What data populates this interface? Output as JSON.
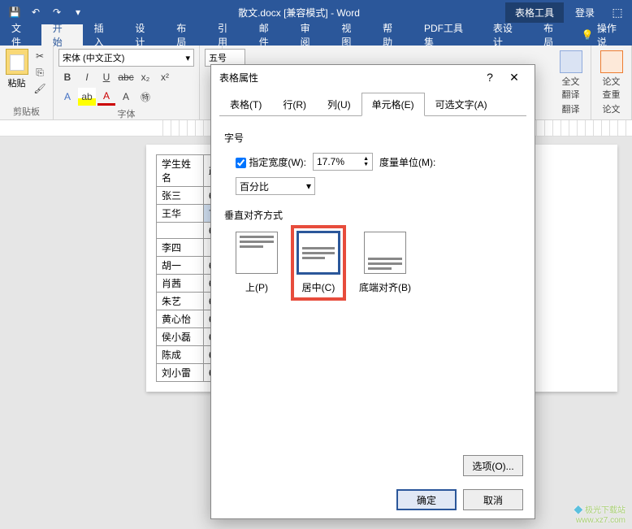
{
  "titlebar": {
    "document_title": "散文.docx [兼容模式] - Word",
    "context_tool": "表格工具",
    "login": "登录"
  },
  "ribbon_tabs": {
    "file": "文件",
    "home": "开始",
    "insert": "插入",
    "design": "设计",
    "layout": "布局",
    "references": "引用",
    "mail": "邮件",
    "review": "审阅",
    "view": "视图",
    "help": "帮助",
    "pdf": "PDF工具集",
    "table_design": "表设计",
    "table_layout": "布局",
    "tell_me": "操作说"
  },
  "ribbon": {
    "clipboard": {
      "paste": "粘贴",
      "label": "剪贴板"
    },
    "font": {
      "font_name": "宋体 (中文正文)",
      "font_size": "五号",
      "label": "字体"
    },
    "translate": {
      "label": "全文\n翻译",
      "group": "翻译"
    },
    "paper": {
      "label": "论文\n查重",
      "group": "论文"
    }
  },
  "table_data": {
    "header": [
      "学生姓名",
      "政治"
    ],
    "rows": [
      [
        "张三",
        "60"
      ],
      [
        "王华",
        "70"
      ],
      [
        "",
        "60"
      ],
      [
        "李四",
        ""
      ],
      [
        "胡一",
        "60"
      ],
      [
        "肖茜",
        "60"
      ],
      [
        "朱艺",
        "60"
      ],
      [
        "黄心怡",
        "60"
      ],
      [
        "侯小磊",
        "60"
      ],
      [
        "陈成",
        "60"
      ],
      [
        "刘小雷",
        "60"
      ]
    ]
  },
  "dialog": {
    "title": "表格属性",
    "tabs": {
      "table": "表格(T)",
      "row": "行(R)",
      "column": "列(U)",
      "cell": "单元格(E)",
      "alt": "可选文字(A)"
    },
    "size_section": "字号",
    "preferred_width_label": "指定宽度(W):",
    "width_value": "17.7%",
    "measure_label": "度量单位(M):",
    "measure_value": "百分比",
    "valign_section": "垂直对齐方式",
    "valign": {
      "top": "上(P)",
      "center": "居中(C)",
      "bottom": "底端对齐(B)"
    },
    "options_btn": "选项(O)...",
    "ok": "确定",
    "cancel": "取消"
  },
  "watermark": {
    "line1": "极光下载站",
    "line2": "www.xz7.com"
  }
}
